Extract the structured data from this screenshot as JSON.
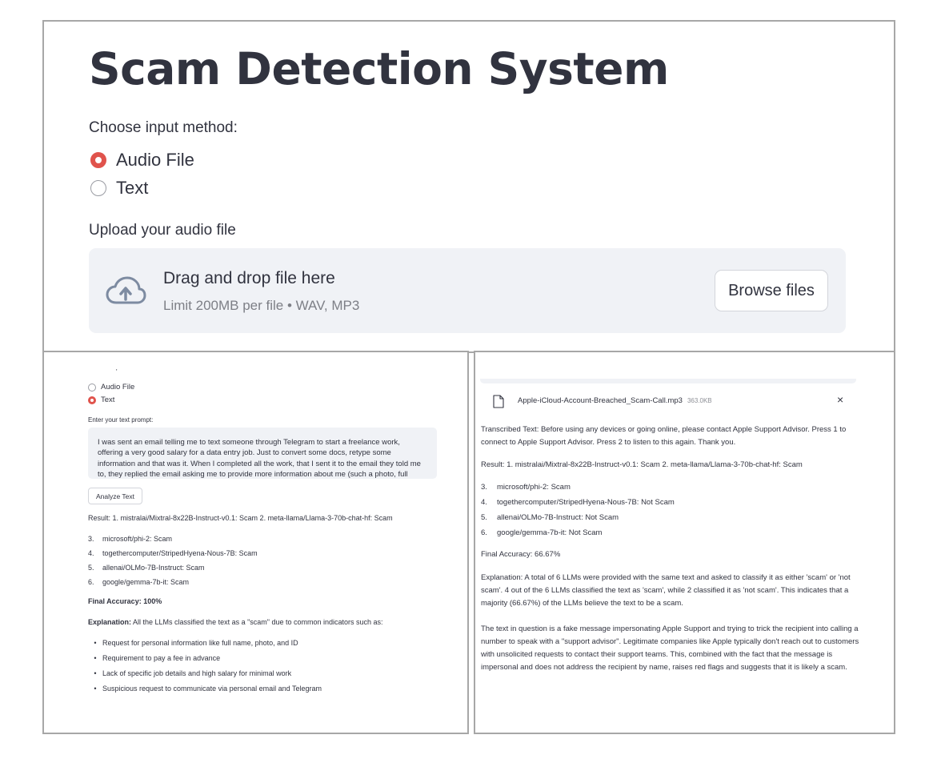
{
  "top": {
    "title": "Scam Detection System",
    "choose_label": "Choose input method:",
    "radio_options": [
      "Audio File",
      "Text"
    ],
    "selected": "Audio File",
    "upload_label": "Upload your audio file",
    "dropzone_title": "Drag and drop file here",
    "dropzone_sub": "Limit 200MB per file • WAV, MP3",
    "browse_label": "Browse files"
  },
  "left": {
    "radio_options": [
      "Audio File",
      "Text"
    ],
    "selected": "Text",
    "prompt_label": "Enter your text prompt:",
    "prompt_value": "I was sent an email telling me to text someone through Telegram to start a freelance work, offering a very good salary for a data entry job. Just to convert some docs, retype some information and that was it. When I completed all the work, that I sent it to the email they told me to, they replied the email asking me to provide more information about me (such a photo, full name, ID) and to pay a",
    "analyze_label": "Analyze Text",
    "result": "Result: 1. mistralai/Mixtral-8x22B-Instruct-v0.1: Scam 2. meta-llama/Llama-3-70b-chat-hf: Scam",
    "list": [
      {
        "n": "3.",
        "text": "microsoft/phi-2: Scam"
      },
      {
        "n": "4.",
        "text": "togethercomputer/StripedHyena-Nous-7B: Scam"
      },
      {
        "n": "5.",
        "text": "allenai/OLMo-7B-Instruct: Scam"
      },
      {
        "n": "6.",
        "text": "google/gemma-7b-it: Scam"
      }
    ],
    "accuracy": "Final Accuracy: 100%",
    "explanation_label": "Explanation:",
    "explanation_text": " All the LLMs classified the text as a \"scam\" due to common indicators such as:",
    "bullets": [
      "Request for personal information like full name, photo, and ID",
      "Requirement to pay a fee in advance",
      "Lack of specific job details and high salary for minimal work",
      "Suspicious request to communicate via personal email and Telegram"
    ]
  },
  "right": {
    "file_name": "Apple-iCloud-Account-Breached_Scam-Call.mp3",
    "file_size": "363.0KB",
    "close_icon": "×",
    "transcribed": "Transcribed Text: Before using any devices or going online, please contact Apple Support Advisor. Press 1 to connect to Apple Support Advisor. Press 2 to listen to this again. Thank you.",
    "result": "Result: 1. mistralai/Mixtral-8x22B-Instruct-v0.1: Scam 2. meta-llama/Llama-3-70b-chat-hf: Scam",
    "list": [
      {
        "n": "3.",
        "text": "microsoft/phi-2: Scam"
      },
      {
        "n": "4.",
        "text": "togethercomputer/StripedHyena-Nous-7B: Not Scam"
      },
      {
        "n": "5.",
        "text": "allenai/OLMo-7B-Instruct: Not Scam"
      },
      {
        "n": "6.",
        "text": "google/gemma-7b-it: Not Scam"
      }
    ],
    "accuracy": "Final Accuracy: 66.67%",
    "explanation": "Explanation: A total of 6 LLMs were provided with the same text and asked to classify it as either 'scam' or 'not scam'. 4 out of the 6 LLMs classified the text as 'scam', while 2 classified it as 'not scam'. This indicates that a majority (66.67%) of the LLMs believe the text to be a scam.",
    "explanation2": "The text in question is a fake message impersonating Apple Support and trying to trick the recipient into calling a number to speak with a \"support advisor\". Legitimate companies like Apple typically don't reach out to customers with unsolicited requests to contact their support teams. This, combined with the fact that the message is impersonal and does not address the recipient by name, raises red flags and suggests that it is likely a scam."
  },
  "colors": {
    "accent": "#e0534c",
    "text": "#31333f",
    "muted": "#7d7f86",
    "surface": "#f0f2f6",
    "border": "#a7a7a7"
  },
  "icons": {
    "upload": "cloud-upload-icon",
    "file": "file-icon",
    "close": "close-icon"
  }
}
